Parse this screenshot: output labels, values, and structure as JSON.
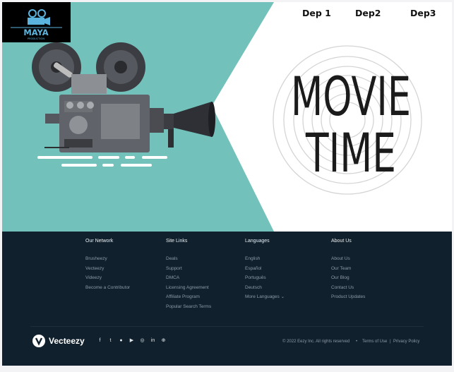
{
  "logo": {
    "title": "MAYA",
    "subtitle": "PRODUCTION"
  },
  "nav": {
    "items": [
      "Dep 1",
      "Dep2",
      "Dep3"
    ]
  },
  "hero": {
    "line1": "MOVIE",
    "line2": "TIME"
  },
  "colors": {
    "teal": "#73c1bb",
    "footer": "#10202c"
  },
  "footer": {
    "columns": [
      {
        "title": "Our Network",
        "links": [
          "Brusheezy",
          "Vecteezy",
          "Videezy",
          "Become a Contributor"
        ]
      },
      {
        "title": "Site Links",
        "links": [
          "Deals",
          "Support",
          "DMCA",
          "Licensing Agreement",
          "Affiliate Program",
          "Popular Search Terms"
        ]
      },
      {
        "title": "Languages",
        "links": [
          "English",
          "Español",
          "Português",
          "Deutsch",
          "More Languages  ⌄"
        ]
      },
      {
        "title": "About Us",
        "links": [
          "About Us",
          "Our Team",
          "Our Blog",
          "Contact Us",
          "Product Updates"
        ]
      }
    ],
    "brand": "Vecteezy",
    "socials": [
      "facebook-icon",
      "twitter-icon",
      "pinterest-icon",
      "youtube-icon",
      "instagram-icon",
      "linkedin-icon",
      "dribbble-icon"
    ],
    "copyright": "© 2022 Eezy Inc. All rights reserved",
    "terms": "Terms of Use",
    "privacy": "Privacy Policy"
  }
}
